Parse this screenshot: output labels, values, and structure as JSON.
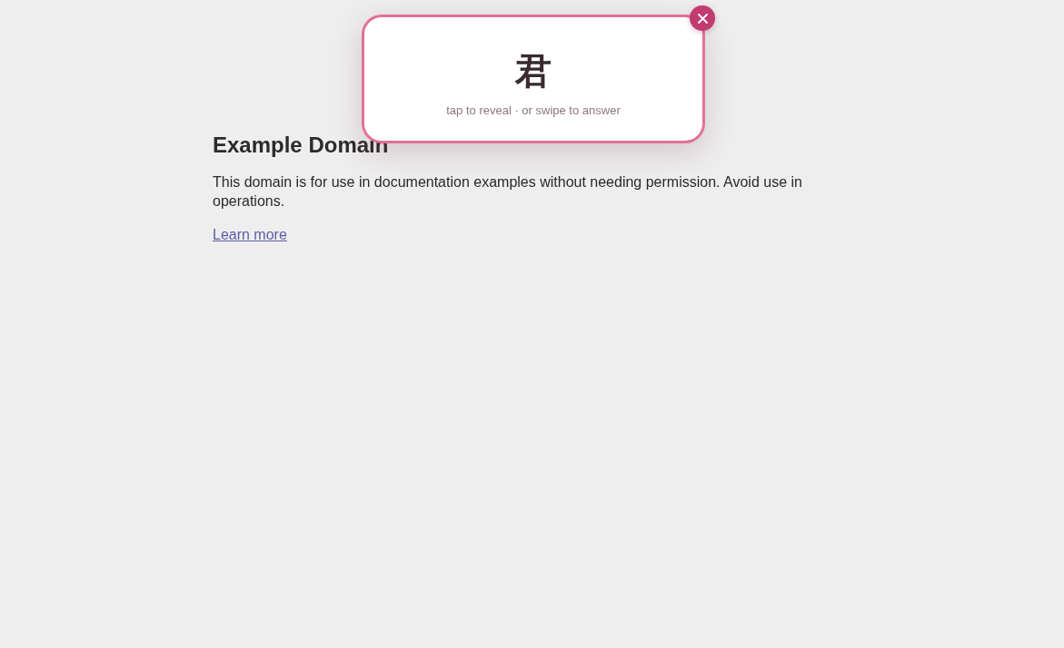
{
  "page": {
    "heading": "Example Domain",
    "paragraph": "This domain is for use in documentation examples without needing permission. Avoid use in operations.",
    "link": "Learn more"
  },
  "flashcard": {
    "character": "君",
    "hint": "tap to reveal · or swipe to answer"
  }
}
